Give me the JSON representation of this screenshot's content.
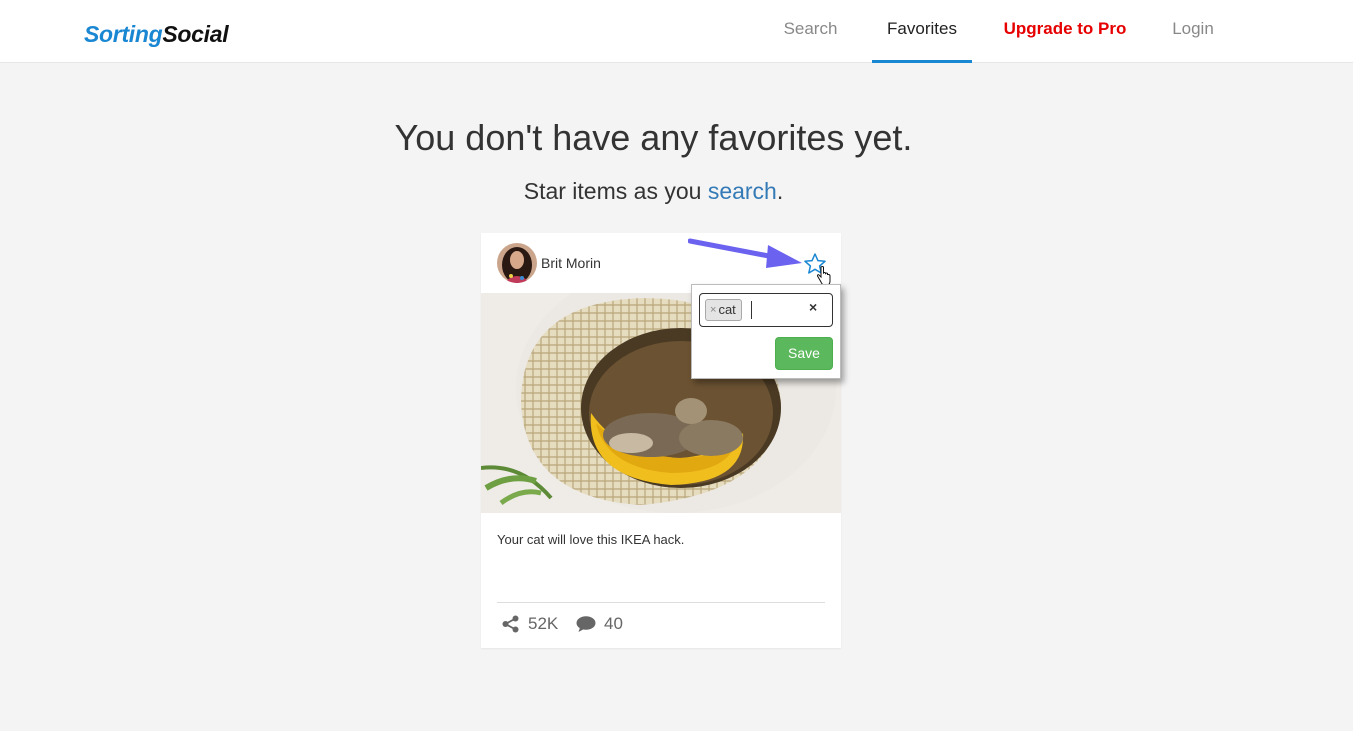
{
  "brand": {
    "part1": "Sorting",
    "part2": "Social",
    "color_primary": "#1a87d3"
  },
  "nav": {
    "search": "Search",
    "favorites": "Favorites",
    "upgrade": "Upgrade to Pro",
    "login": "Login",
    "active": "favorites"
  },
  "empty_state": {
    "headline": "You don't have any favorites yet.",
    "sub_prefix": "Star items as you ",
    "sub_link": "search",
    "sub_suffix": "."
  },
  "card": {
    "author": "Brit Morin",
    "caption": "Your cat will love this IKEA hack.",
    "shares": "52K",
    "comments": "40",
    "star_icon": "star-outline-icon"
  },
  "tag_popover": {
    "tags": [
      "cat"
    ],
    "tag_remove": "×",
    "clear": "×",
    "save_label": "Save",
    "save_color": "#5cb85c"
  },
  "annotation": {
    "arrow_color": "#6b63f0"
  }
}
